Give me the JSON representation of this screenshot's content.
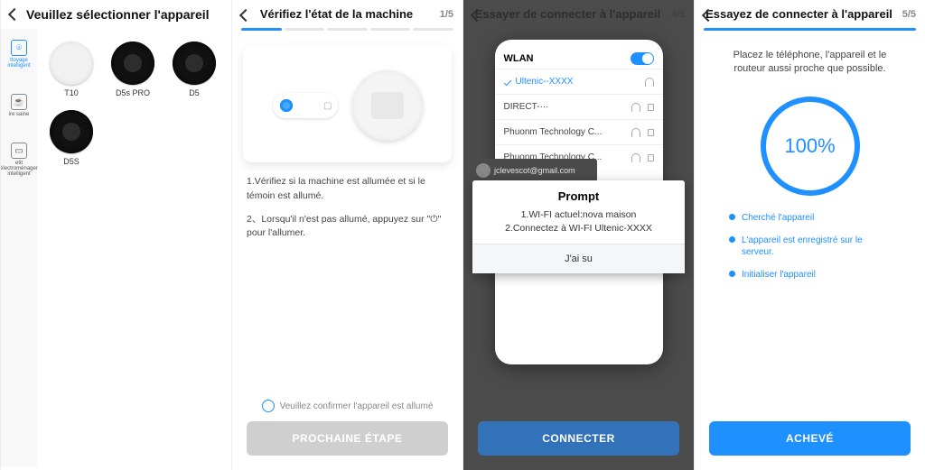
{
  "screen1": {
    "title": "Veuillez sélectionner l'appareil",
    "sidebar": [
      {
        "label": "ttoyage intelligent"
      },
      {
        "label": "ire saine"
      },
      {
        "label": "etit électroménager intelligent"
      }
    ],
    "devices": [
      {
        "name": "T10",
        "white": true
      },
      {
        "name": "D5s PRO",
        "white": false
      },
      {
        "name": "D5",
        "white": false
      },
      {
        "name": "D5S",
        "white": false
      }
    ]
  },
  "screen2": {
    "title": "Vérifiez l'état de la machine",
    "step": "1/5",
    "line1": "1.Vérifiez si la machine est allumée et si le témoin est allumé.",
    "line2": "2、Lorsqu'il n'est pas allumé, appuyez sur \"⏻\" pour l'allumer.",
    "confirm": "Veuillez confirmer l'appareil est allumé",
    "button": "PROCHAINE ÉTAPE"
  },
  "screen3": {
    "title": "Essayer de connecter à l'appareil",
    "step": "4/5",
    "wlan_header": "WLAN",
    "ssid_selected": "Ultenic--XXXX",
    "user_email": "jclevescot@gmail.com",
    "prompt_title": "Prompt",
    "prompt_line1": "1.WI-FI actuel:nova maison",
    "prompt_line2": "2.Connectez à WI-FI Ultenic-XXXX",
    "prompt_ok": "J'ai su",
    "button": "CONNECTER"
  },
  "screen4": {
    "title": "Essayez de connecter à l'appareil",
    "step": "5/5",
    "message": "Placez le téléphone, l'appareil et le routeur aussi proche que possible.",
    "percent": "100%",
    "steps": [
      "Cherché l'appareil",
      "L'appareil est enregistré sur le serveur.",
      "Initialiser l'appareil"
    ],
    "button": "ACHEVÉ"
  }
}
